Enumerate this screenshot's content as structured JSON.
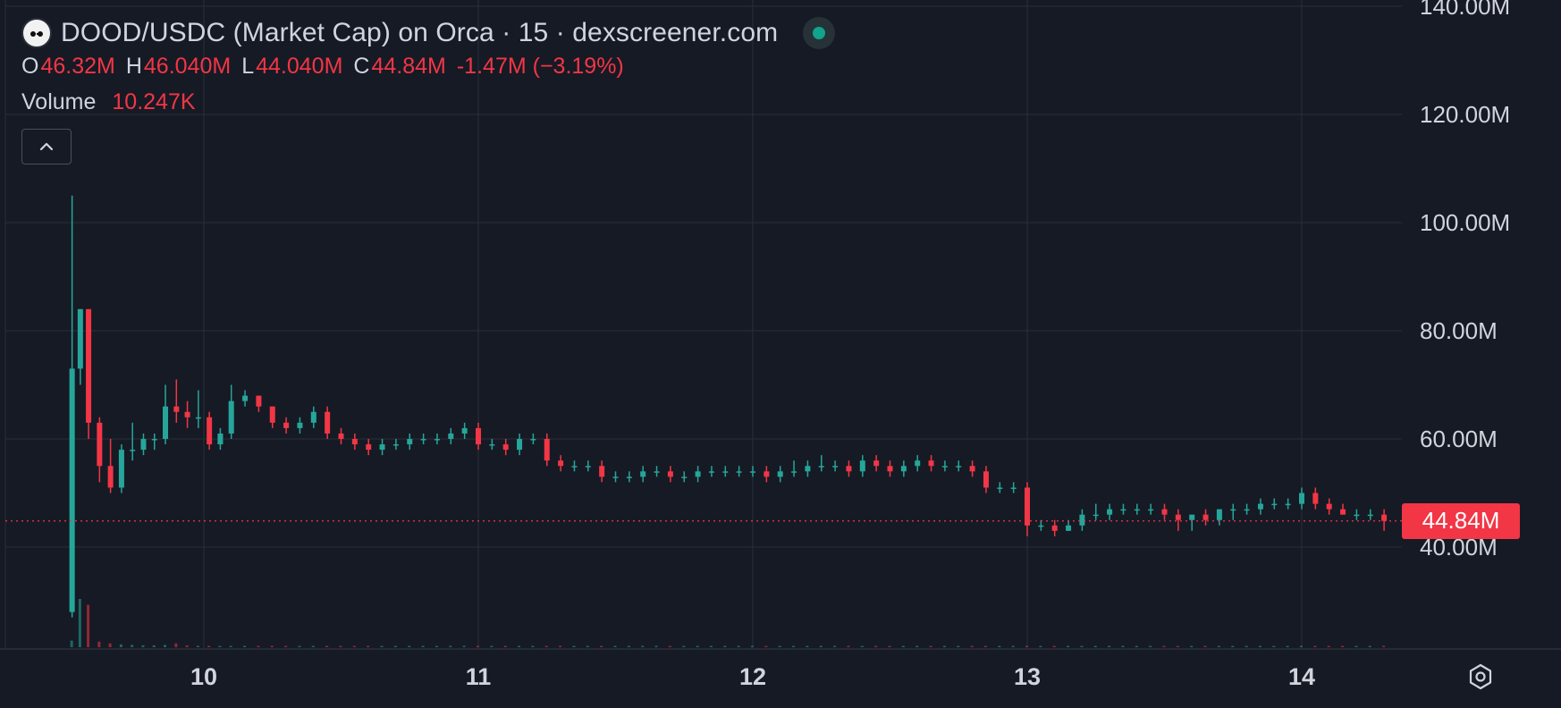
{
  "legend": {
    "title": "DOOD/USDC (Market Cap) on Orca · 15 · dexscreener.com",
    "ohlc": {
      "open_key": "O",
      "open": "46.32M",
      "high_key": "H",
      "high": "46.040M",
      "low_key": "L",
      "low": "44.040M",
      "close_key": "C",
      "close": "44.84M",
      "change": "-1.47M (−3.19%)"
    },
    "volume_label": "Volume",
    "volume_value": "10.247K",
    "collapse_icon": "chevron-up-icon"
  },
  "settings_icon": "gear-icon",
  "colors": {
    "background": "#161a25",
    "up": "#26a69a",
    "down": "#f23645",
    "grid": "#2a2e39",
    "text": "#d1d4dc",
    "live_dot": "#11a38b"
  },
  "chart_data": {
    "type": "candlestick",
    "title": "DOOD/USDC (Market Cap) on Orca · 15 · dexscreener.com",
    "xlabel": "",
    "ylabel": "",
    "ylim": [
      20,
      140
    ],
    "xlim": [
      9.5,
      14.3
    ],
    "yticks": [
      40,
      60,
      80,
      100,
      120,
      140
    ],
    "ytick_labels": [
      "40.00M",
      "60.00M",
      "80.00M",
      "100.00M",
      "120.00M",
      "140.00M"
    ],
    "xticks": [
      10,
      11,
      12,
      13,
      14
    ],
    "xtick_labels": [
      "10",
      "11",
      "12",
      "13",
      "14"
    ],
    "grid": true,
    "last_price": 44.84,
    "last_price_label": "44.84M",
    "series": [
      {
        "name": "Market Cap",
        "x": [
          9.52,
          9.55,
          9.58,
          9.62,
          9.66,
          9.7,
          9.74,
          9.78,
          9.82,
          9.86,
          9.9,
          9.94,
          9.98,
          10.02,
          10.06,
          10.1,
          10.15,
          10.2,
          10.25,
          10.3,
          10.35,
          10.4,
          10.45,
          10.5,
          10.55,
          10.6,
          10.65,
          10.7,
          10.75,
          10.8,
          10.85,
          10.9,
          10.95,
          11.0,
          11.05,
          11.1,
          11.15,
          11.2,
          11.25,
          11.3,
          11.35,
          11.4,
          11.45,
          11.5,
          11.55,
          11.6,
          11.65,
          11.7,
          11.75,
          11.8,
          11.85,
          11.9,
          11.95,
          12.0,
          12.05,
          12.1,
          12.15,
          12.2,
          12.25,
          12.3,
          12.35,
          12.4,
          12.45,
          12.5,
          12.55,
          12.6,
          12.65,
          12.7,
          12.75,
          12.8,
          12.85,
          12.9,
          12.95,
          13.0,
          13.05,
          13.1,
          13.15,
          13.2,
          13.25,
          13.3,
          13.35,
          13.4,
          13.45,
          13.5,
          13.55,
          13.6,
          13.65,
          13.7,
          13.75,
          13.8,
          13.85,
          13.9,
          13.95,
          14.0,
          14.05,
          14.1,
          14.15,
          14.2,
          14.25,
          14.3
        ],
        "open": [
          28,
          73,
          84,
          63,
          55,
          51,
          58,
          58,
          60,
          60,
          66,
          65,
          64,
          64,
          59,
          61,
          67,
          68,
          66,
          63,
          62,
          63,
          65,
          61,
          60,
          59,
          58,
          59,
          59,
          60,
          60,
          60,
          61,
          62,
          59,
          59,
          58,
          60,
          60,
          56,
          55,
          55,
          55,
          53,
          53,
          53,
          54,
          54,
          53,
          53,
          54,
          54,
          54,
          54,
          54,
          53,
          54,
          54,
          55,
          55,
          55,
          54,
          56,
          55,
          54,
          55,
          56,
          55,
          55,
          55,
          54,
          51,
          51,
          51,
          44,
          44,
          43,
          44,
          46,
          46,
          47,
          47,
          47,
          47,
          46,
          45,
          46,
          45,
          47,
          47,
          47,
          48,
          48,
          48,
          50,
          48,
          47,
          46,
          46,
          46
        ],
        "close": [
          73,
          84,
          63,
          55,
          51,
          58,
          58,
          60,
          60,
          66,
          65,
          64,
          64,
          59,
          61,
          67,
          68,
          66,
          63,
          62,
          63,
          65,
          61,
          60,
          59,
          58,
          59,
          59,
          60,
          60,
          60,
          61,
          62,
          59,
          59,
          58,
          60,
          60,
          56,
          55,
          55,
          55,
          53,
          53,
          53,
          54,
          54,
          53,
          53,
          54,
          54,
          54,
          54,
          54,
          53,
          54,
          54,
          55,
          55,
          55,
          54,
          56,
          55,
          54,
          55,
          56,
          55,
          55,
          55,
          54,
          51,
          51,
          51,
          44,
          44,
          43,
          44,
          46,
          46,
          47,
          47,
          47,
          47,
          46,
          45,
          46,
          45,
          47,
          47,
          47,
          48,
          48,
          48,
          50,
          48,
          47,
          46,
          46,
          46,
          44.84
        ],
        "high": [
          105,
          84,
          84,
          64,
          60,
          59,
          63,
          61,
          61,
          70,
          71,
          67,
          69,
          65,
          62,
          70,
          69,
          67,
          66,
          64,
          64,
          66,
          66,
          62,
          61,
          60,
          60,
          60,
          61,
          61,
          61,
          62,
          63,
          63,
          60,
          60,
          61,
          61,
          61,
          57,
          56,
          56,
          56,
          54,
          54,
          55,
          55,
          55,
          54,
          55,
          55,
          55,
          55,
          55,
          55,
          55,
          56,
          56,
          57,
          56,
          56,
          57,
          57,
          56,
          56,
          57,
          57,
          56,
          56,
          56,
          55,
          52,
          52,
          52,
          45,
          45,
          45,
          47,
          48,
          48,
          48,
          48,
          48,
          48,
          47,
          46,
          47,
          47,
          48,
          48,
          49,
          49,
          49,
          51,
          51,
          49,
          48,
          47,
          47,
          47
        ],
        "low": [
          27,
          70,
          60,
          52,
          50,
          50,
          56,
          57,
          58,
          59,
          63,
          62,
          62,
          58,
          58,
          60,
          66,
          65,
          62,
          61,
          61,
          62,
          60,
          59,
          58,
          57,
          57,
          58,
          58,
          59,
          59,
          59,
          60,
          58,
          58,
          57,
          57,
          59,
          55,
          54,
          54,
          54,
          52,
          52,
          52,
          52,
          53,
          52,
          52,
          52,
          53,
          53,
          53,
          53,
          52,
          52,
          53,
          53,
          54,
          54,
          53,
          53,
          54,
          53,
          53,
          54,
          54,
          54,
          54,
          53,
          50,
          50,
          50,
          42,
          43,
          42,
          43,
          43,
          45,
          45,
          46,
          46,
          46,
          45,
          43,
          43,
          44,
          44,
          45,
          46,
          46,
          47,
          47,
          47,
          47,
          46,
          46,
          45,
          45,
          43
        ],
        "volume": [
          1400,
          10247,
          9000,
          1200,
          800,
          600,
          500,
          400,
          400,
          500,
          800,
          400,
          300,
          300,
          250,
          250,
          300,
          250,
          250,
          200,
          200,
          200,
          200,
          180,
          180,
          160,
          160,
          160,
          150,
          150,
          150,
          150,
          150,
          180,
          150,
          150,
          140,
          140,
          150,
          130,
          130,
          120,
          120,
          120,
          120,
          120,
          120,
          120,
          120,
          120,
          120,
          120,
          120,
          120,
          120,
          120,
          120,
          120,
          120,
          120,
          120,
          120,
          120,
          120,
          120,
          120,
          120,
          120,
          120,
          120,
          120,
          120,
          120,
          200,
          150,
          150,
          120,
          120,
          120,
          120,
          120,
          120,
          120,
          120,
          120,
          120,
          120,
          120,
          120,
          120,
          120,
          120,
          120,
          130,
          120,
          120,
          120,
          120,
          120,
          120
        ]
      }
    ]
  }
}
